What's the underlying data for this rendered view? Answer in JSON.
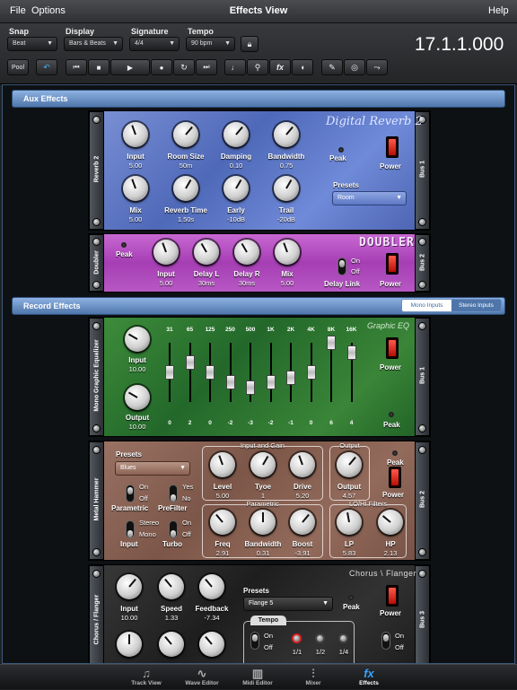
{
  "menu": {
    "file": "File",
    "options": "Options",
    "title": "Effects View",
    "help": "Help"
  },
  "toolbar": {
    "snap": {
      "label": "Snap",
      "value": "Beat"
    },
    "display": {
      "label": "Display",
      "value": "Bars & Beats"
    },
    "signature": {
      "label": "Signature",
      "value": "4/4"
    },
    "tempo": {
      "label": "Tempo",
      "value": "90 bpm"
    },
    "position": "17.1.1.000",
    "pool": "Pool",
    "icons": [
      "undo-icon",
      "rewind-icon",
      "stop-icon",
      "play-icon",
      "record-icon",
      "loop-icon",
      "forward-icon",
      "metronome-icon",
      "zoom-icon",
      "fx-icon",
      "duck-icon",
      "wrench-icon",
      "binoculars-icon",
      "route-icon"
    ],
    "fx": "fx"
  },
  "aux": {
    "header": "Aux Effects"
  },
  "reverb": {
    "name": "Digital Reverb 2",
    "side": "Reverb 2",
    "bus": "Bus 1",
    "knobs": [
      {
        "label": "Input",
        "value": "5.00"
      },
      {
        "label": "Room Size",
        "value": "50m"
      },
      {
        "label": "Damping",
        "value": "0.10"
      },
      {
        "label": "Bandwidth",
        "value": "0.75"
      },
      {
        "label": "Mix",
        "value": "5.00"
      },
      {
        "label": "Reverb Time",
        "value": "1.50s"
      },
      {
        "label": "Early",
        "value": "-10dB"
      },
      {
        "label": "Trail",
        "value": "-20dB"
      }
    ],
    "peak": "Peak",
    "power": "Power",
    "presets_label": "Presets",
    "preset": "Room"
  },
  "doubler": {
    "name": "DOUBLER",
    "side": "Doubler",
    "bus": "Bus 2",
    "peak": "Peak",
    "knobs": [
      {
        "label": "Input",
        "value": "5.00"
      },
      {
        "label": "Delay L",
        "value": "30ms"
      },
      {
        "label": "Delay R",
        "value": "30ms"
      },
      {
        "label": "Mix",
        "value": "5.00"
      }
    ],
    "toggle_on": "On",
    "toggle_off": "Off",
    "delay_link": "Delay Link",
    "power": "Power"
  },
  "record": {
    "header": "Record Effects",
    "mono": "Mono Inputs",
    "stereo": "Stereo Inputs"
  },
  "eq": {
    "name": "Graphic EQ",
    "side": "Mono Graphic Equalizer",
    "bus": "Bus 1",
    "input": {
      "label": "Input",
      "value": "10.00"
    },
    "output": {
      "label": "Output",
      "value": "10.00"
    },
    "bands": [
      {
        "freq": "31",
        "value": "0",
        "gain": 0
      },
      {
        "freq": "65",
        "value": "2",
        "gain": 2
      },
      {
        "freq": "125",
        "value": "0",
        "gain": 0
      },
      {
        "freq": "250",
        "value": "-2",
        "gain": -2
      },
      {
        "freq": "500",
        "value": "-3",
        "gain": -3
      },
      {
        "freq": "1K",
        "value": "-2",
        "gain": -2
      },
      {
        "freq": "2K",
        "value": "-1",
        "gain": -1
      },
      {
        "freq": "4K",
        "value": "0",
        "gain": 0
      },
      {
        "freq": "8K",
        "value": "6",
        "gain": 6
      },
      {
        "freq": "16K",
        "value": "4",
        "gain": 4
      }
    ],
    "power": "Power",
    "peak": "Peak"
  },
  "hammer": {
    "side": "Metal Hammer",
    "bus": "Bus 2",
    "presets_label": "Presets",
    "preset": "Blues",
    "parametric": "Parametric",
    "prefilter": "PreFilter",
    "input": "Input",
    "turbo": "Turbo",
    "on": "On",
    "off": "Off",
    "yes": "Yes",
    "no": "No",
    "stereo": "Stereo",
    "mono": "Mono",
    "group_input": "Input and Gain",
    "group_output": "Output",
    "group_param": "Parametric",
    "group_lohi": "LO/HI Filters",
    "knobs": [
      {
        "label": "Level",
        "value": "5.00"
      },
      {
        "label": "Tyoe",
        "value": "1"
      },
      {
        "label": "Drive",
        "value": "5.20"
      },
      {
        "label": "Output",
        "value": "4.57"
      },
      {
        "label": "Freq",
        "value": "2.91"
      },
      {
        "label": "Bandwidth",
        "value": "0.31"
      },
      {
        "label": "Boost",
        "value": "-3.91"
      },
      {
        "label": "LP",
        "value": "5.83"
      },
      {
        "label": "HP",
        "value": "2.13"
      }
    ],
    "peak": "Peak",
    "power": "Power"
  },
  "chorus": {
    "name": "Chorus \\ Flanger",
    "side": "Chorus / Flanger",
    "bus": "Bus 3",
    "knobs": [
      {
        "label": "Input",
        "value": "10.00"
      },
      {
        "label": "Speed",
        "value": "1.33"
      },
      {
        "label": "Feedback",
        "value": "-7.34"
      }
    ],
    "presets_label": "Presets",
    "preset": "Flange 5",
    "peak": "Peak",
    "power": "Power",
    "tempo": "Tempo",
    "on": "On",
    "off": "Off",
    "notes": [
      "1/1",
      "1/2",
      "1/4"
    ]
  },
  "tabs": [
    {
      "label": "Track View",
      "icon": "♫"
    },
    {
      "label": "Wave Editor",
      "icon": "∿"
    },
    {
      "label": "Midi Editor",
      "icon": "▥"
    },
    {
      "label": "Mixer",
      "icon": "⫶"
    },
    {
      "label": "Effects",
      "icon": "fx"
    }
  ],
  "active_tab": "Effects"
}
